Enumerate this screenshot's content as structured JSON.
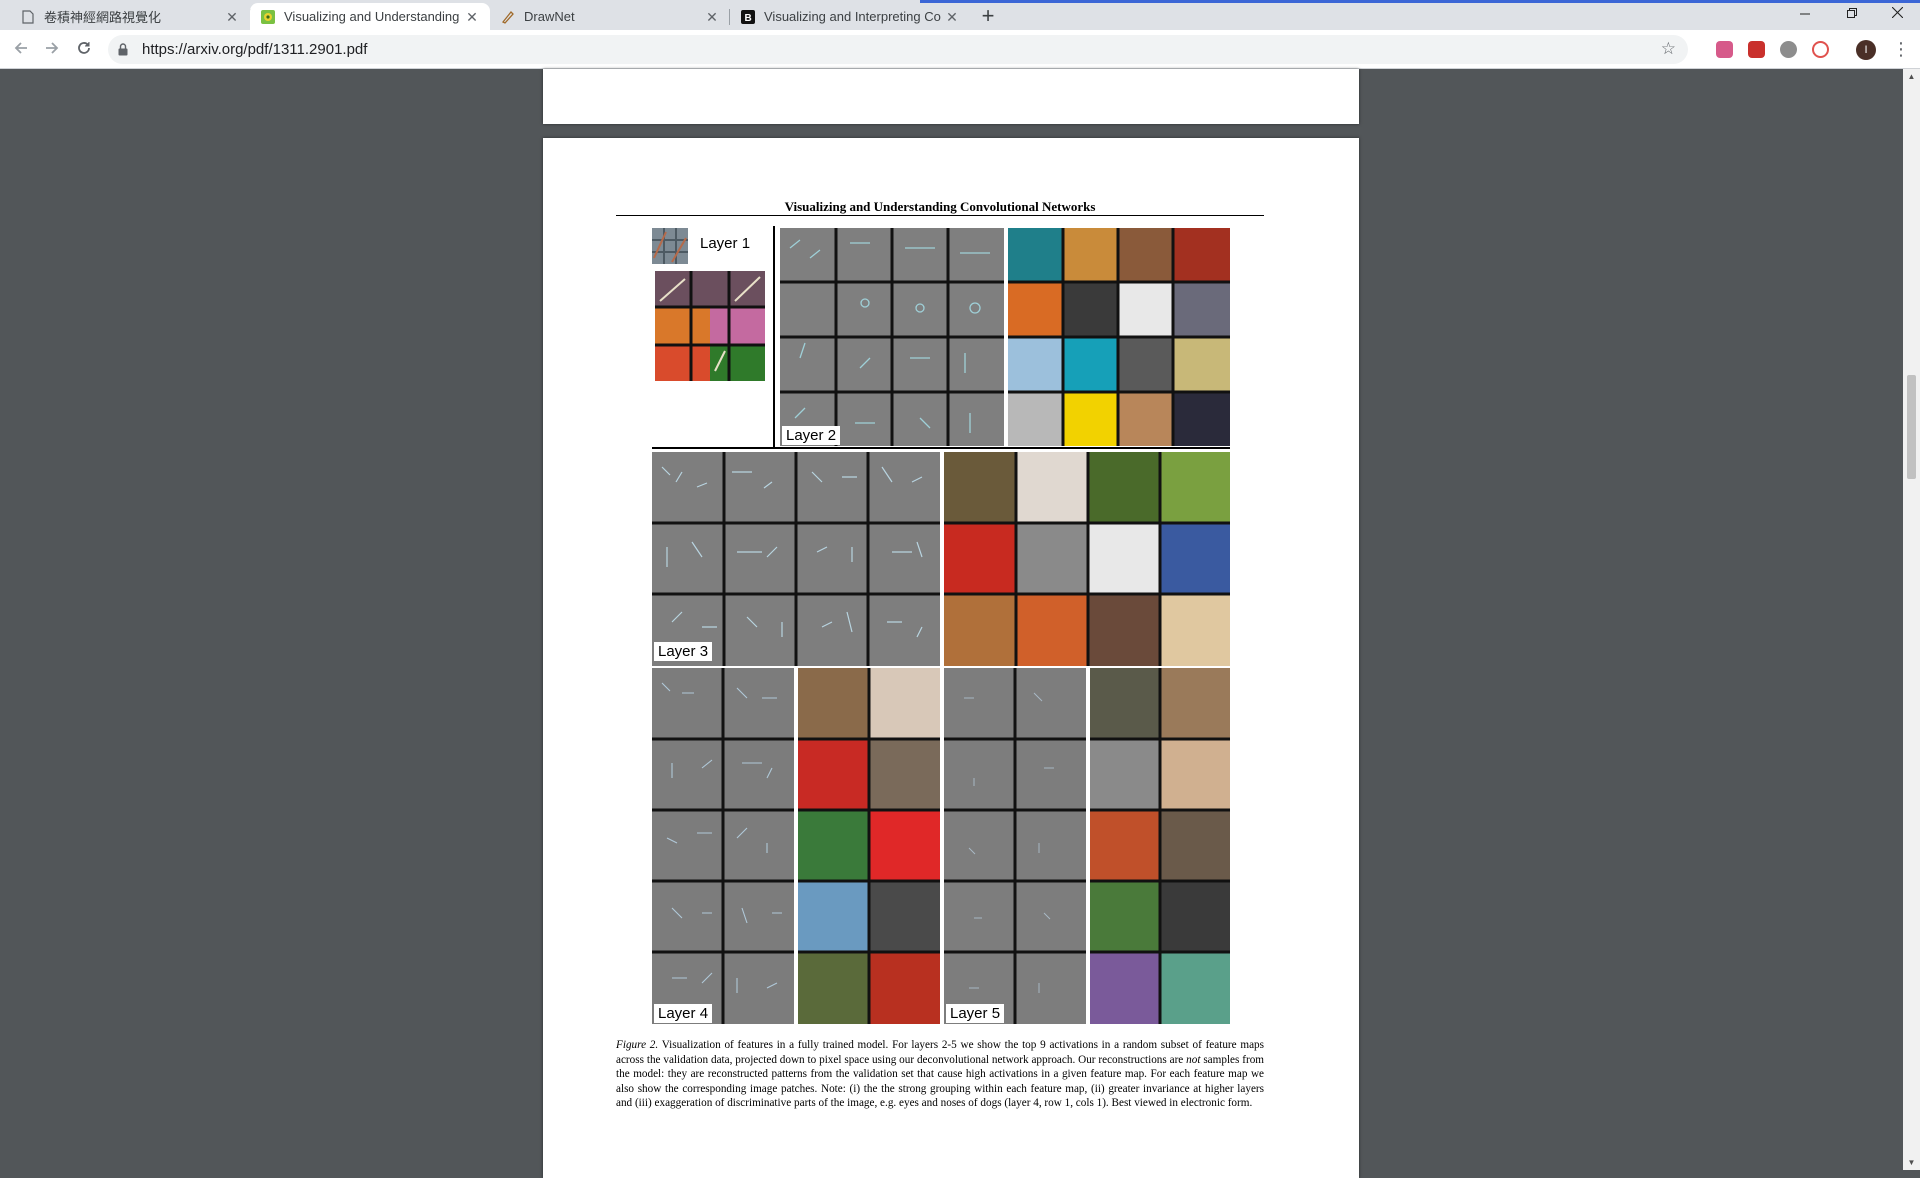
{
  "browser": {
    "tabs": [
      {
        "title": "卷積神經網路視覺化",
        "favicon": "doc-icon",
        "active": false
      },
      {
        "title": "Visualizing and Understanding",
        "favicon": "arxiv-icon",
        "active": true
      },
      {
        "title": "DrawNet",
        "favicon": "drawnet-icon",
        "active": false
      },
      {
        "title": "Visualizing and Interpreting Co",
        "favicon": "b-icon",
        "active": false
      }
    ],
    "url": "https://arxiv.org/pdf/1311.2901.pdf",
    "close_glyph": "✕",
    "new_tab_glyph": "+",
    "profile_initial": "I"
  },
  "pdf": {
    "running_head": "Visualizing and Understanding Convolutional Networks",
    "figure_labels": {
      "layer1": "Layer 1",
      "layer2": "Layer 2",
      "layer3": "Layer 3",
      "layer4": "Layer 4",
      "layer5": "Layer 5"
    },
    "caption": {
      "figure_ref": "Figure 2.",
      "part1": " Visualization of features in a fully trained model. For layers 2-5 we show the top 9 activations in a random subset of feature maps across the validation data, projected down to pixel space using our deconvolutional network approach. Our reconstructions are ",
      "emph": "not",
      "part2": " samples from the model: they are reconstructed patterns from the validation set that cause high activations in a given feature map. For each feature map we also show the corresponding image patches. Note: (i) the the strong grouping within each feature map, (ii) greater invariance at higher layers and (iii) exaggeration of discriminative parts of the image, e.g. eyes and noses of dogs (layer 4, row 1, cols 1). Best viewed in electronic form."
    }
  },
  "colors": {
    "accent": "#3b66d6",
    "viewer_bg": "#525659",
    "tabstrip_bg": "#dee1e6"
  }
}
